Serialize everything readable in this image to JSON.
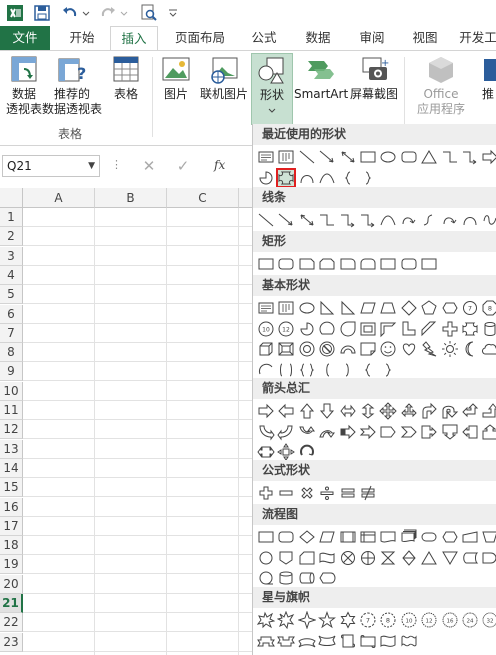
{
  "tabs": [
    "文件",
    "开始",
    "插入",
    "页面布局",
    "公式",
    "数据",
    "审阅",
    "视图",
    "开发工"
  ],
  "active_tab": "插入",
  "ribbon": {
    "pivot_line1": "数据",
    "pivot_line2": "透视表",
    "rec_pivot_line1": "推荐的",
    "rec_pivot_line2": "数据透视表",
    "table": "表格",
    "group_tables": "表格",
    "picture": "图片",
    "online_picture": "联机图片",
    "shapes": "形状",
    "smartart": "SmartArt",
    "screenshot": "屏幕截图",
    "office_line1": "Office",
    "office_line2": "应用程序",
    "rec_cut": "推"
  },
  "formula_bar": {
    "name_box": "Q21",
    "fx": "fx"
  },
  "grid": {
    "columns": [
      "A",
      "B",
      "C"
    ],
    "rows": [
      "1",
      "2",
      "3",
      "4",
      "5",
      "6",
      "7",
      "8",
      "9",
      "10",
      "11",
      "12",
      "13",
      "14",
      "15",
      "16",
      "17",
      "18",
      "19",
      "20",
      "21",
      "22",
      "23"
    ],
    "selected_row": "21"
  },
  "shapes_menu": {
    "sections": [
      "最近使用的形状",
      "线条",
      "矩形",
      "基本形状",
      "箭头总汇",
      "公式形状",
      "流程图",
      "星与旗帜"
    ]
  },
  "colors": {
    "accent": "#217346",
    "highlight": "#e02020"
  }
}
